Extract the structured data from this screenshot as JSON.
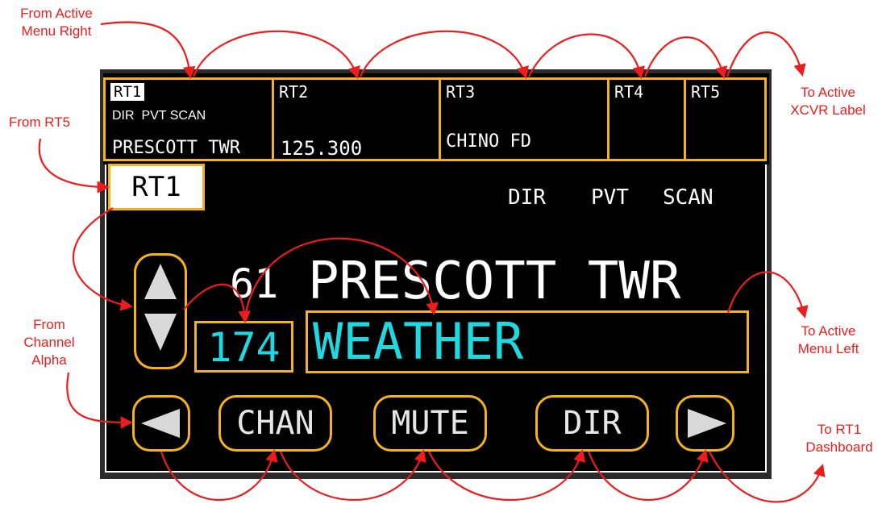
{
  "annotations": {
    "from_active_menu_right": [
      "From Active",
      "Menu Right"
    ],
    "from_rt5": "From RT5",
    "from_channel_alpha": [
      "From",
      "Channel",
      "Alpha"
    ],
    "to_active_xcvr_label": [
      "To Active",
      "XCVR Label"
    ],
    "to_active_menu_left": [
      "To Active",
      "Menu Left"
    ],
    "to_rt1_dashboard": [
      "To RT1",
      "Dashboard"
    ]
  },
  "tabs": [
    {
      "label": "RT1",
      "modes": "DIR  PVT SCAN",
      "name": "PRESCOTT TWR"
    },
    {
      "label": "RT2",
      "freq": "125.300"
    },
    {
      "label": "RT3",
      "name": "CHINO FD"
    },
    {
      "label": "RT4"
    },
    {
      "label": "RT5"
    }
  ],
  "active": {
    "label": "RT1",
    "modes": [
      "DIR",
      "PVT",
      "SCAN"
    ],
    "channel_number": "61",
    "channel_name": "PRESCOTT TWR",
    "alt_channel_number": "174",
    "alt_channel_name": "WEATHER"
  },
  "buttons": {
    "left": "◀",
    "chan": "CHAN",
    "mute": "MUTE",
    "dir": "DIR",
    "right": "▶"
  },
  "colors": {
    "highlight": "#f5b21b",
    "arrow": "#ee1c1c",
    "selected_text": "#1fd8e0"
  }
}
